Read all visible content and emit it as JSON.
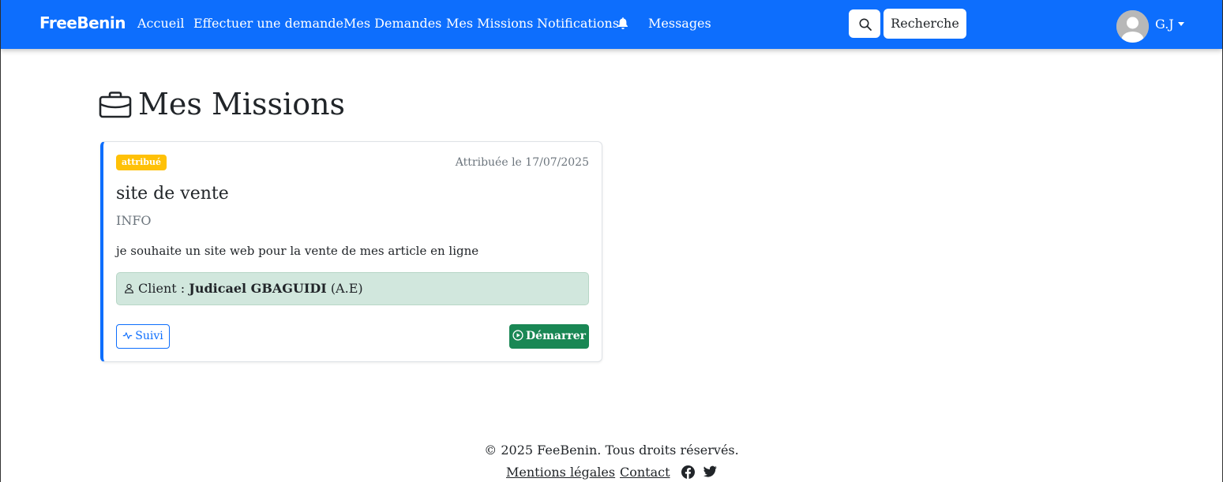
{
  "navbar": {
    "brand": "FreeBenin",
    "links": [
      "Accueil",
      "Effectuer une demande",
      "Mes Demandes",
      "Mes Missions",
      "Notifications",
      "Messages"
    ],
    "search_button_icon": "search-icon",
    "search_label": "Recherche",
    "user_initials": "G.J",
    "accent_color": "#0d6efd"
  },
  "page": {
    "title_icon": "briefcase-icon",
    "title": "Mes Missions"
  },
  "mission": {
    "status_badge": "attribué",
    "assigned_date": "Attribuée le 17/07/2025",
    "title": "site de vente",
    "category": "INFO",
    "description": "je souhaite un site web pour la vente de mes article en ligne",
    "client_label": "Client :",
    "client_name": "Judicael GBAGUIDI",
    "client_suffix": "(A.E)",
    "follow_button": "Suivi",
    "start_button": "Démarrer",
    "badge_color": "#ffc107",
    "start_color": "#198754"
  },
  "footer": {
    "copyright": "© 2025 FeeBenin. Tous droits réservés.",
    "links": [
      "Mentions légales",
      "Contact"
    ],
    "social_icons": [
      "facebook-icon",
      "twitter-icon"
    ]
  }
}
